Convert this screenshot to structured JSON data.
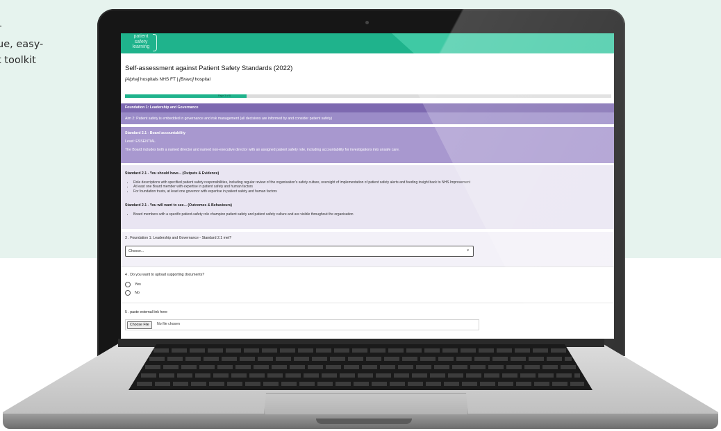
{
  "left_text": {
    "lines": [
      "r",
      "ue, easy-",
      "t toolkit"
    ]
  },
  "app": {
    "logo_lines": [
      "patient",
      "safety",
      "learning"
    ],
    "page_title": "Self-assessment against Patient Safety Standards (2022)",
    "org": {
      "alpha": "[Alpha]",
      "middle": " hospitals NHS FT | ",
      "bravo": "[Bravo]",
      "suffix": " hospital"
    },
    "progress": {
      "percent": 25,
      "label": "Page 3 of 8"
    },
    "foundation": "Foundation 1: Leadership and Governance",
    "aim": "Aim 2: Patient safety is embedded in governance and risk management (all decisions are informed by and consider patient safety)",
    "standard": {
      "title": "Standard 2.1 - Board accountability",
      "level": "Level: ESSENTIAL",
      "description": "The Board includes both a named director and named non-executive director with an assigned patient safety role, including accountability for investigations into unsafe care."
    },
    "outputs": {
      "title": "Standard 2.1 - You should have... (Outputs & Evidence)",
      "items": [
        "Role descriptions with specified patient safety responsibilities, including regular review of the organisation's safety culture, oversight of implementation of patient safety alerts and feeding insight back to NHS Improvement",
        "At least one Board member with expertise in patient safety and human factors",
        "For foundation trusts, at least one governor with expertise in patient safety and human factors"
      ]
    },
    "outcomes": {
      "title": "Standard 2.1 - You will want to see... (Outcomes & Behaviours)",
      "items": [
        "Board members with a specific patient-safety role champion patient safety and patient safety culture and are visible throughout the organisation"
      ]
    },
    "q3": {
      "label": "3 . Foundation 1: Leadership and Governance - Standard 2.1 met?",
      "selected": "Choose..."
    },
    "q4": {
      "label": "4 . Do you want to upload supporting documents?",
      "options": [
        "Yes",
        "No"
      ]
    },
    "q5": {
      "label": "5 . paste external link here",
      "button": "Choose File",
      "status": "No file chosen"
    }
  },
  "colors": {
    "brand": "#1fb38c",
    "purple": "#8876b9"
  }
}
